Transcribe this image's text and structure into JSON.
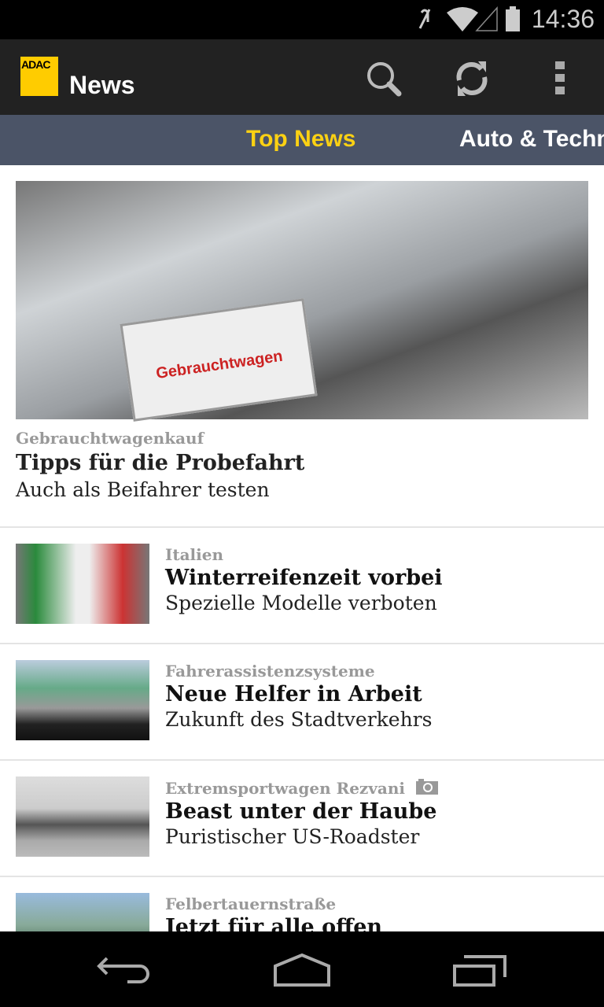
{
  "status_bar": {
    "time": "14:36",
    "icons": [
      "mute-icon",
      "wifi-icon",
      "signal-icon",
      "battery-icon"
    ]
  },
  "app_bar": {
    "logo_text": "ADAC",
    "title": "News",
    "actions": [
      "search-icon",
      "refresh-icon",
      "overflow-menu-icon"
    ]
  },
  "tabs": [
    {
      "label": "Top News",
      "active": true
    },
    {
      "label": "Auto & Technik",
      "active": false
    }
  ],
  "colors": {
    "accent": "#fbd113",
    "tab_bar": "#4b5467",
    "app_bar": "#222222"
  },
  "featured": {
    "image_text": "Gebrauchtwagen",
    "kicker": "Gebrauchtwagenkauf",
    "title": "Tipps für die Probefahrt",
    "subtitle": "Auch als Beifahrer testen"
  },
  "articles": [
    {
      "kicker": "Italien",
      "title": "Winterreifenzeit vorbei",
      "subtitle": "Spezielle Modelle verboten"
    },
    {
      "kicker": "Fahrerassistenzsysteme",
      "title": "Neue Helfer in Arbeit",
      "subtitle": "Zukunft des Stadtverkehrs"
    },
    {
      "kicker": "Extremsportwagen Rezvani",
      "title": "Beast unter der Haube",
      "subtitle": "Puristischer US-Roadster",
      "gallery_icon": "camera-icon"
    },
    {
      "kicker": "Felbertauernstraße",
      "title": "Jetzt für alle offen",
      "subtitle": ""
    }
  ]
}
